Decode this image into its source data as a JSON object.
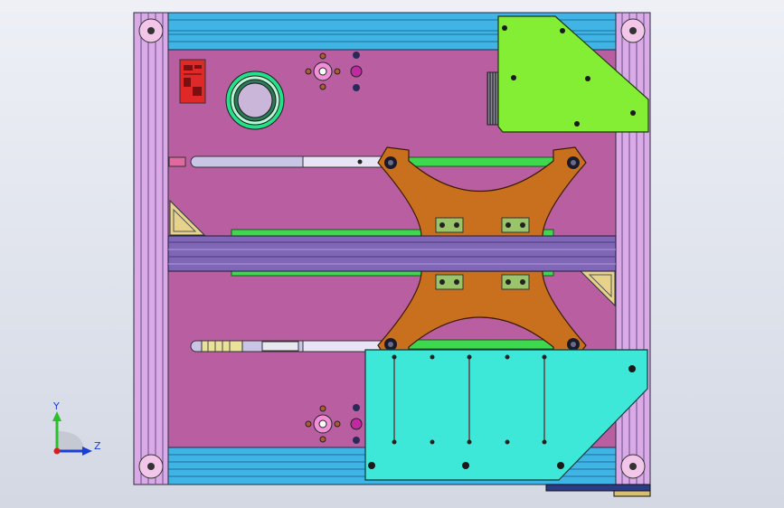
{
  "triad": {
    "y_label": "Y",
    "z_label": "Z"
  },
  "colors": {
    "background_top": "#eef0f6",
    "background_bottom": "#d3d8e3",
    "plate": "#b85fa0",
    "rail_cyan": "#3fb5e6",
    "side_rail": "#d9a9e6",
    "green_bracket": "#84ee34",
    "cyan_bracket": "#3ee8d8",
    "gantry": "#c86f1e",
    "beam": "#8064b4",
    "green_bar": "#3ed84e",
    "triad_y": "#2bbf2b",
    "triad_z": "#1b3fd6",
    "triad_origin": "#d62020"
  },
  "icons": [
    "connector-block-icon",
    "ring-bearing-icon",
    "fan-icon",
    "triad-icon"
  ]
}
